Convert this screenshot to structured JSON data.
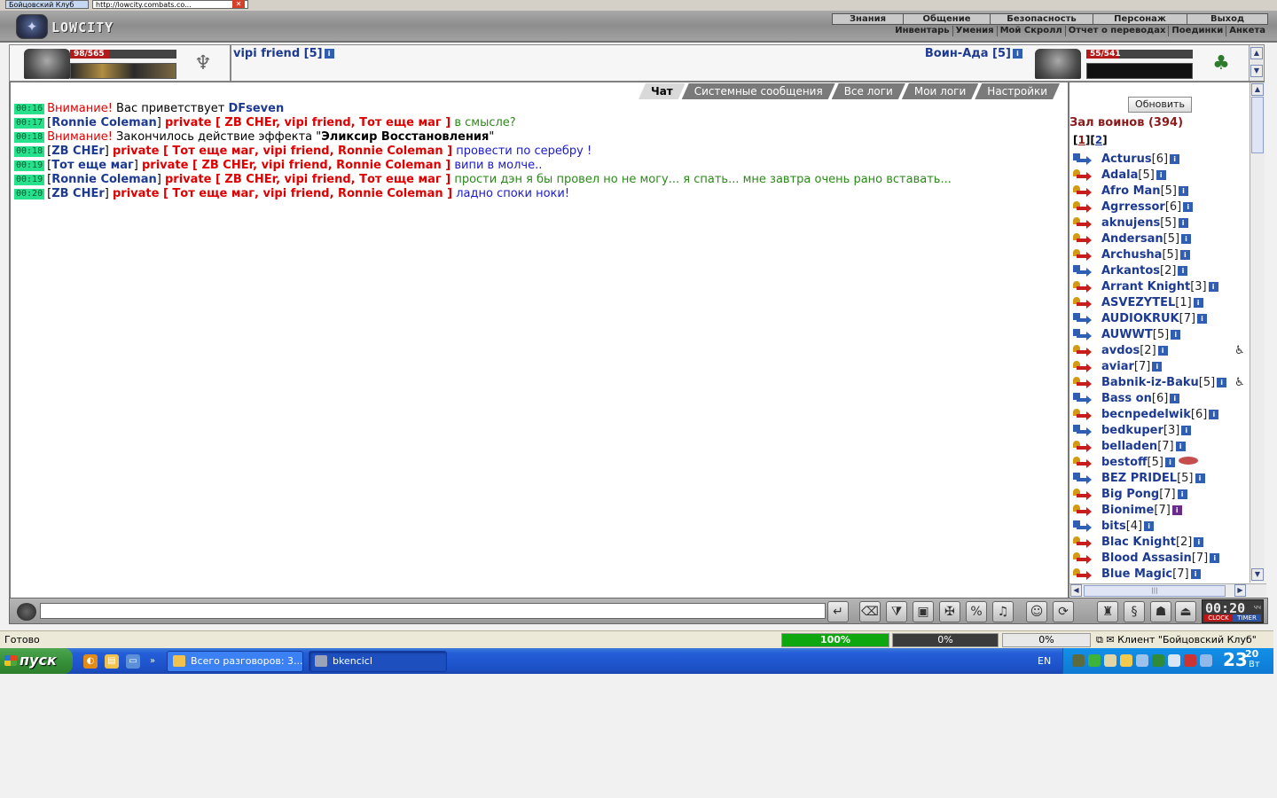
{
  "browser": {
    "tab1": "Бойцовский Клуб",
    "tab2": "http://lowcity.combats.co...",
    "close_icon": "close-icon"
  },
  "header": {
    "logo": "LOWCITY",
    "menu_top": [
      "Знания",
      "Общение",
      "Безопасность",
      "Персонаж",
      "Выход"
    ],
    "menu_sub": [
      "Инвентарь",
      "Умения",
      "Мой Скролл",
      "Отчет о переводах",
      "Поединки",
      "Анкета"
    ]
  },
  "player_left": {
    "hp": "98/565",
    "hp_fraction": 0.17,
    "name": "vipi friend [5]"
  },
  "player_right": {
    "hp": "55/541",
    "hp_fraction": 0.1,
    "name": "Воин-Ада [5]"
  },
  "chat": {
    "tabs": [
      "Чат",
      "Системные сообщения",
      "Все логи",
      "Мои логи",
      "Настройки"
    ],
    "active_tab": "Чат",
    "messages": [
      {
        "time": "00:16",
        "parts": [
          {
            "t": "Внимание!",
            "c": "warn"
          },
          {
            "t": " Вас приветствует ",
            "c": "br"
          },
          {
            "t": "DFseven",
            "c": "nick"
          }
        ]
      },
      {
        "time": "00:17",
        "parts": [
          {
            "t": "[",
            "c": "br"
          },
          {
            "t": "Ronnie Coleman",
            "c": "nick"
          },
          {
            "t": "] ",
            "c": "br"
          },
          {
            "t": "private [ ZB CHEr, vipi friend, Тот еще маг ]",
            "c": "priv"
          },
          {
            "t": " в смысле?",
            "c": "txt-green"
          }
        ]
      },
      {
        "time": "00:18",
        "parts": [
          {
            "t": "Внимание!",
            "c": "warn"
          },
          {
            "t": " Закончилось действие эффекта \"",
            "c": "br"
          },
          {
            "t": "Эликсир Восстановления",
            "c": "br bold"
          },
          {
            "t": "\"",
            "c": "br"
          }
        ]
      },
      {
        "time": "00:18",
        "parts": [
          {
            "t": "[",
            "c": "br"
          },
          {
            "t": "ZB CHEr",
            "c": "nick"
          },
          {
            "t": "] ",
            "c": "br"
          },
          {
            "t": "private [ Тот еще маг, vipi friend, Ronnie Coleman ]",
            "c": "priv"
          },
          {
            "t": " провести по серебру !",
            "c": "txt-blue"
          }
        ]
      },
      {
        "time": "00:19",
        "parts": [
          {
            "t": "[",
            "c": "br"
          },
          {
            "t": "Тот еще маг",
            "c": "nick"
          },
          {
            "t": "] ",
            "c": "br"
          },
          {
            "t": "private [ ZB CHEr, vipi friend, Ronnie Coleman ]",
            "c": "priv"
          },
          {
            "t": " випи в молче..",
            "c": "txt-blue"
          }
        ]
      },
      {
        "time": "00:19",
        "parts": [
          {
            "t": "[",
            "c": "br"
          },
          {
            "t": "Ronnie Coleman",
            "c": "nick"
          },
          {
            "t": "] ",
            "c": "br"
          },
          {
            "t": "private [ ZB CHEr, vipi friend, Тот еще маг ]",
            "c": "priv"
          },
          {
            "t": " прости дэн я бы провел но не могу... я спать... мне завтра очень рано вставать...",
            "c": "txt-green"
          }
        ]
      },
      {
        "time": "00:20",
        "parts": [
          {
            "t": "[",
            "c": "br"
          },
          {
            "t": "ZB CHEr",
            "c": "nick"
          },
          {
            "t": "] ",
            "c": "br"
          },
          {
            "t": "private [ Тот еще маг, vipi friend, Ronnie Coleman ]",
            "c": "priv"
          },
          {
            "t": " ладно споки ноки!",
            "c": "txt-blue"
          }
        ]
      }
    ],
    "input_value": ""
  },
  "sidebar": {
    "refresh": "Обновить",
    "hall_title": "Зал воинов (394)",
    "pages": [
      "1",
      "2"
    ],
    "current_page": "1",
    "players": [
      {
        "name": "Acturus",
        "level": "[6]",
        "icon": "blue"
      },
      {
        "name": "Adala",
        "level": "[5]",
        "icon": "red"
      },
      {
        "name": "Afro Man",
        "level": "[5]",
        "icon": "red"
      },
      {
        "name": "Agrressor",
        "level": "[6]",
        "icon": "red"
      },
      {
        "name": "aknujens",
        "level": "[5]",
        "icon": "red"
      },
      {
        "name": "Andersan",
        "level": "[5]",
        "icon": "red"
      },
      {
        "name": "Archusha",
        "level": "[5]",
        "icon": "red"
      },
      {
        "name": "Arkantos",
        "level": "[2]",
        "icon": "blue"
      },
      {
        "name": "Arrant Knight",
        "level": "[3]",
        "icon": "red"
      },
      {
        "name": "ASVEZYTEL",
        "level": "[1]",
        "icon": "red"
      },
      {
        "name": "AUDIOKRUK",
        "level": "[7]",
        "icon": "blue"
      },
      {
        "name": "AUWWT",
        "level": "[5]",
        "icon": "blue"
      },
      {
        "name": "avdos",
        "level": "[2]",
        "icon": "red",
        "extra": "sick"
      },
      {
        "name": "aviar",
        "level": "[7]",
        "icon": "red"
      },
      {
        "name": "Babnik-iz-Baku",
        "level": "[5]",
        "icon": "red",
        "extra": "sick"
      },
      {
        "name": "Bass on",
        "level": "[6]",
        "icon": "blue"
      },
      {
        "name": "becnpedelwik",
        "level": "[6]",
        "icon": "red"
      },
      {
        "name": "bedkuper",
        "level": "[3]",
        "icon": "blue"
      },
      {
        "name": "belladen",
        "level": "[7]",
        "icon": "red"
      },
      {
        "name": "bestoff",
        "level": "[5]",
        "icon": "red",
        "extra": "fish"
      },
      {
        "name": "BEZ PRIDEL",
        "level": "[5]",
        "icon": "blue"
      },
      {
        "name": "Big Pong",
        "level": "[7]",
        "icon": "red"
      },
      {
        "name": "Bionime",
        "level": "[7]",
        "icon": "red"
      },
      {
        "name": "bits",
        "level": "[4]",
        "icon": "blue"
      },
      {
        "name": "Blac Knight",
        "level": "[2]",
        "icon": "red"
      },
      {
        "name": "Blood Assasin",
        "level": "[7]",
        "icon": "red"
      },
      {
        "name": "Blue Magic",
        "level": "[7]",
        "icon": "red"
      }
    ]
  },
  "toolbar": {
    "clock_time": "00:20",
    "clock_suffix": "чч",
    "clock_label": "CLOCK",
    "timer_label": "TIMER"
  },
  "statusbar": {
    "status": "Готово",
    "progress1": "100%",
    "progress2": "0%",
    "progress3": "0%",
    "zone": "Клиент \"Бойцовский Клуб\""
  },
  "taskbar": {
    "start": "пуск",
    "task1": "Всего разговоров: 3...",
    "task2": "bkencicl",
    "lang": "EN",
    "time_hour": "23",
    "time_min": "20",
    "day": "Вт"
  },
  "colors": {
    "nick": "#1d3a93",
    "private": "#e00000",
    "timestamp_bg": "#26e08c",
    "hall_title": "#8b1a1a"
  }
}
